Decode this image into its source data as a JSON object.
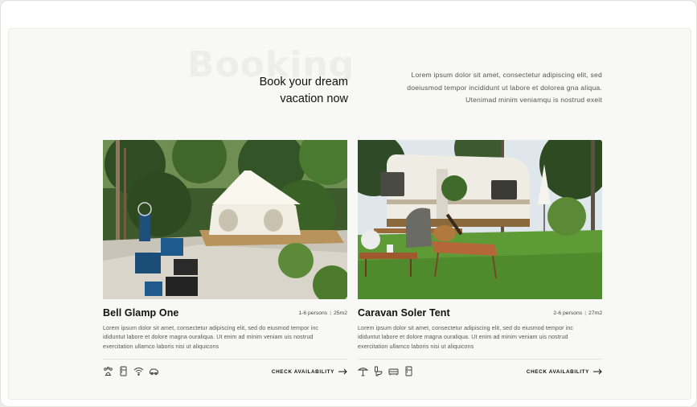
{
  "hero": {
    "watermark": "Booking",
    "headline_line1": "Book your dream",
    "headline_line2": "vacation now",
    "intro_line1": "Lorem ipsum dolor sit amet, consectetur adipiscing elit, sed",
    "intro_line2": "doeiusmod tempor incididunt ut labore et dolorea gna aliqua.",
    "intro_line3": "Utenimad minim veniamqu is nostrud exeit"
  },
  "cards": [
    {
      "title": "Bell Glamp One",
      "persons": "1-6 persons",
      "area": "25m2",
      "desc_line1": "Lorem ipsum dolor sit amet, consectetur adipiscing elit, sed do eiusmod tempor inc",
      "desc_line2": "ididuntut labore et dolore magna ouraliqua. Ut enim ad minim veniam uis nostrud",
      "desc_line3": "exercitation ullamco laboris nisi ut aliquicons",
      "amenities": [
        "pets-icon",
        "fridge-icon",
        "wifi-icon",
        "car-icon"
      ],
      "cta": "CHECK AVAILABILITY"
    },
    {
      "title": "Caravan Soler Tent",
      "persons": "2-6 persons",
      "area": "27m2",
      "desc_line1": "Lorem ipsum dolor sit amet, consectetur adipiscing elit, sed do eiusmod tempor inc",
      "desc_line2": "ididuntut labore et dolore magna ouraliqua. Ut enim ad minim veniam uis nostrud",
      "desc_line3": "exercitation ullamco laboris nisi ut aliquicons",
      "amenities": [
        "umbrella-icon",
        "toilet-icon",
        "sofa-icon",
        "fridge-icon"
      ],
      "cta": "CHECK AVAILABILITY"
    }
  ],
  "colors": {
    "background": "#f8f8f6",
    "text": "#111111",
    "muted": "#555555",
    "grass": "#5e9a36",
    "forest": "#2e4a23"
  }
}
